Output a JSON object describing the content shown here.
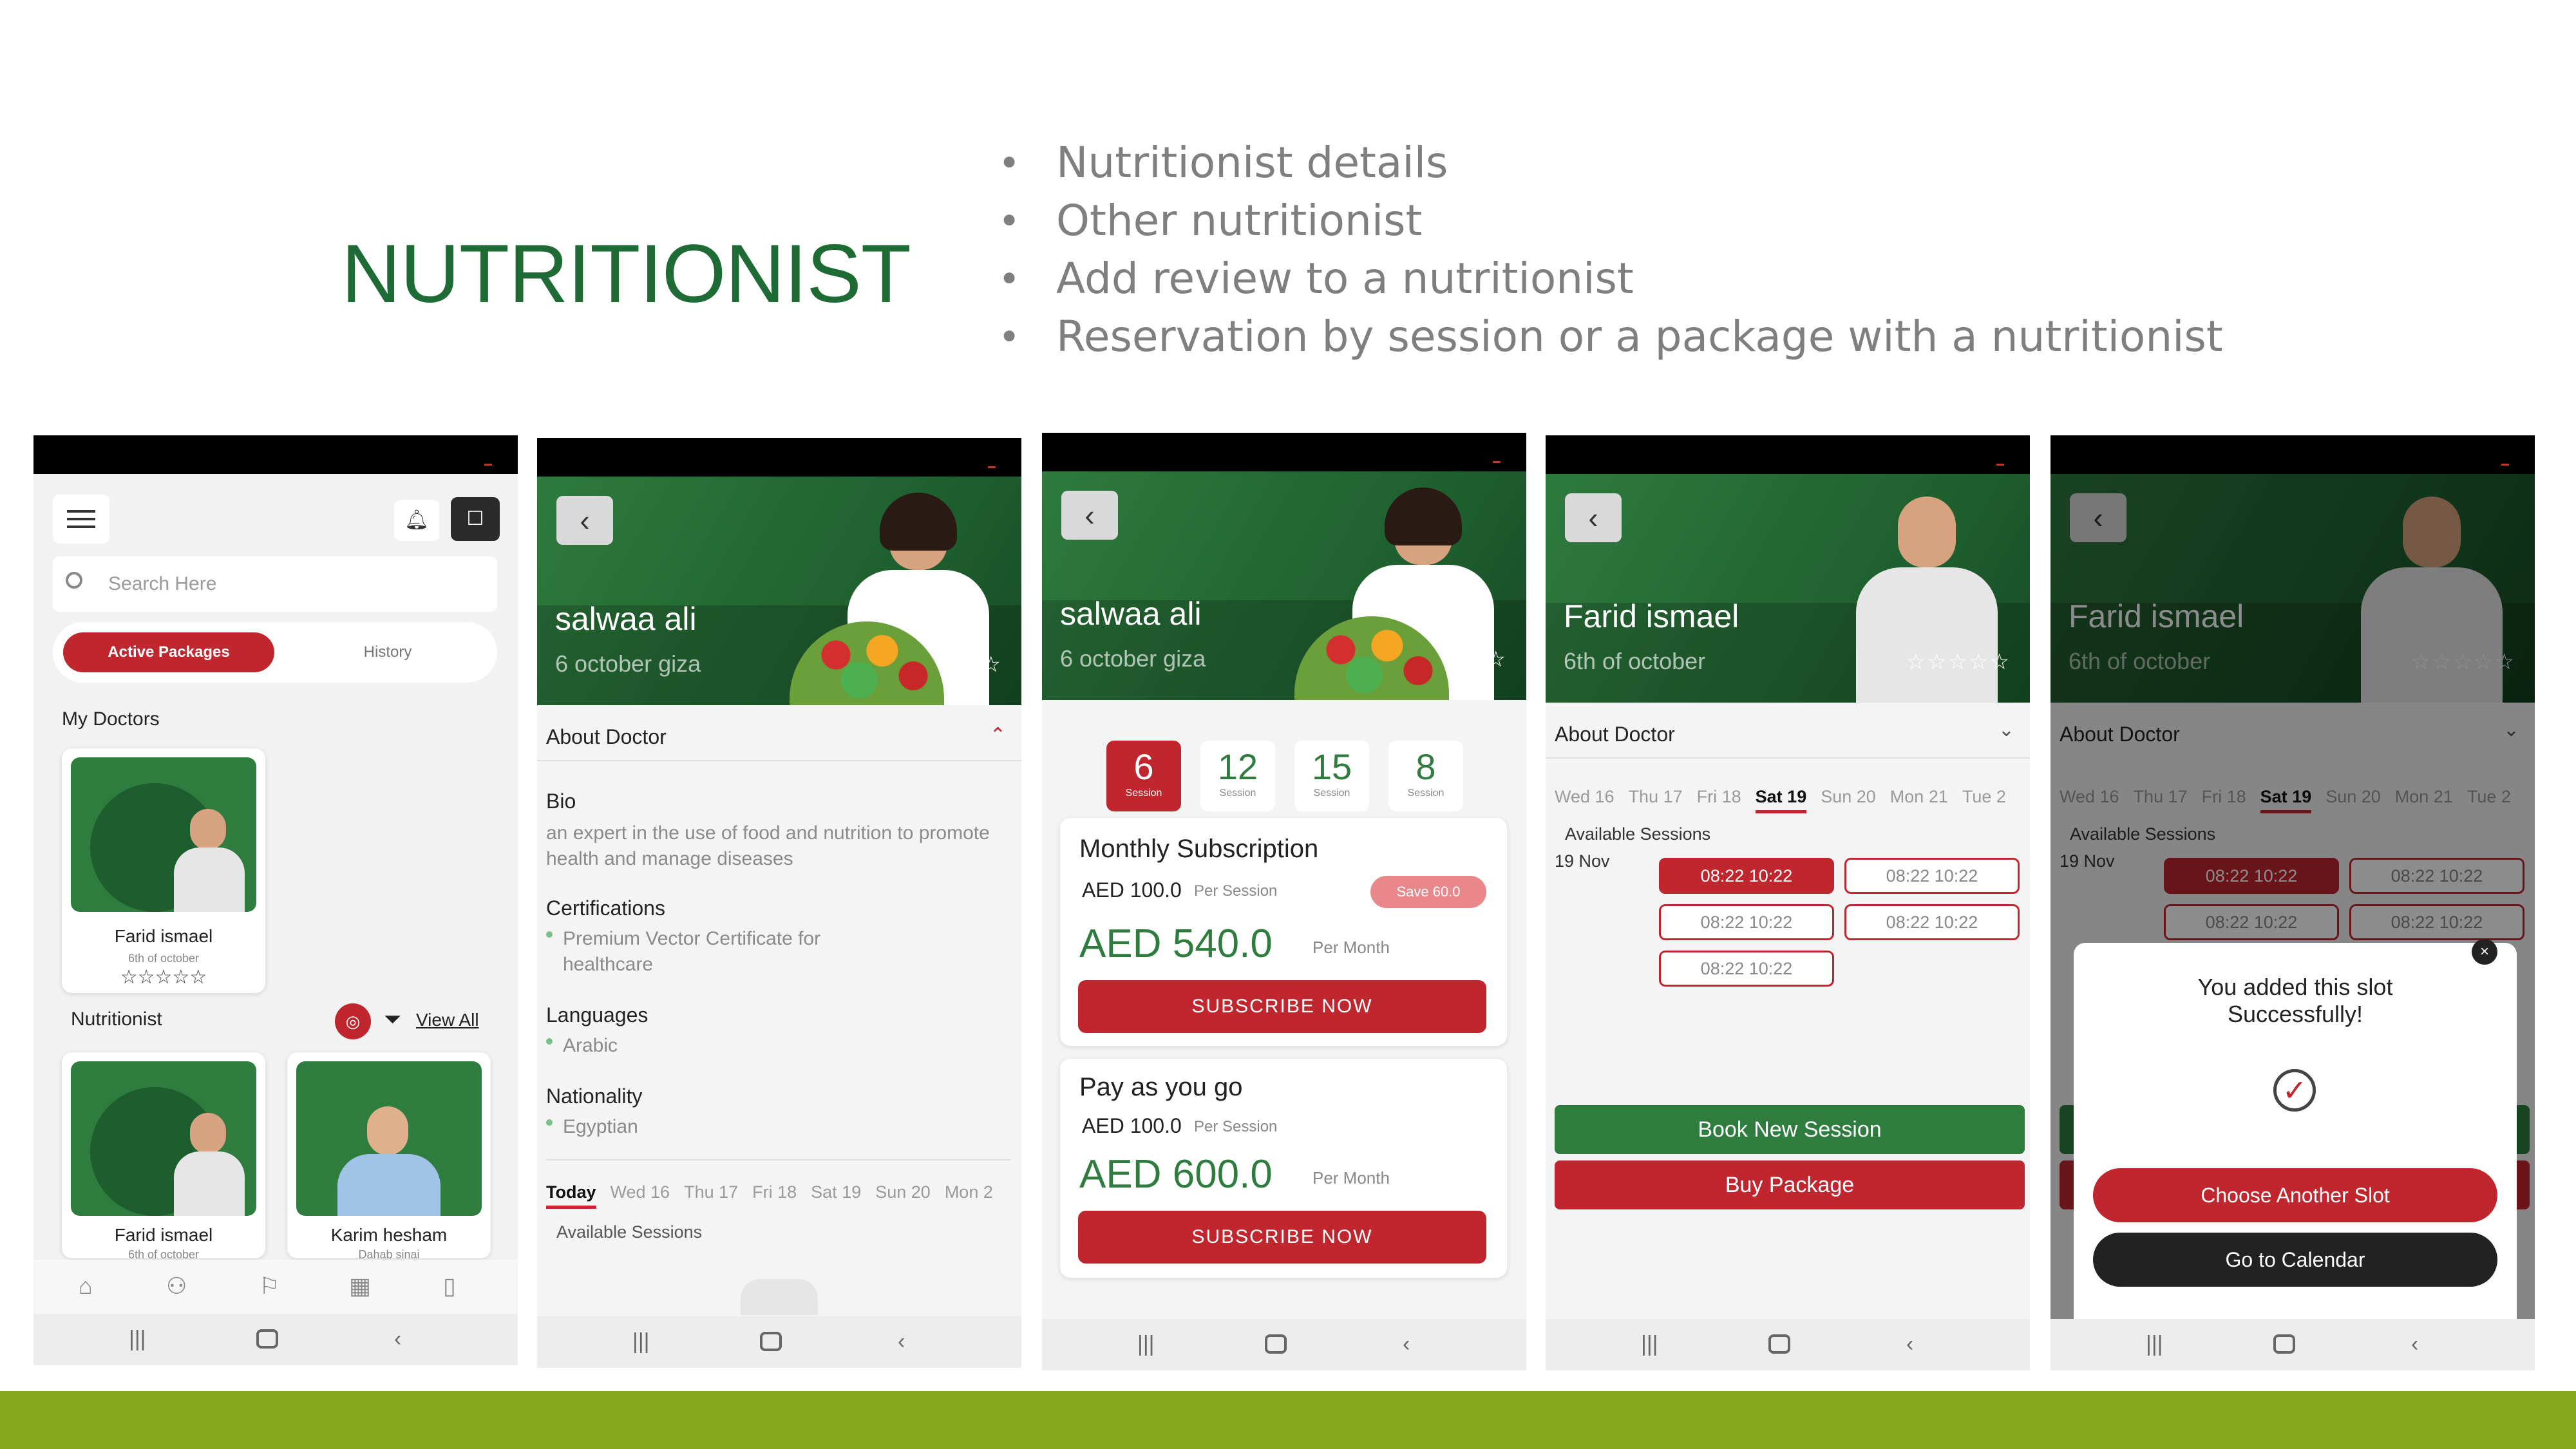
{
  "slide": {
    "title": "NUTRITIONIST",
    "bullets": [
      "Nutritionist details",
      "Other nutritionist",
      "Add review to a nutritionist",
      "Reservation by session or a package with a nutritionist"
    ],
    "colors": {
      "title": "#1f6b35",
      "bullet_text": "#7f7f7f",
      "bottom_bar": "#86a81e",
      "brand_green": "#2e7d3e",
      "brand_red": "#c0262e"
    }
  },
  "screen1": {
    "search_placeholder": "Search Here",
    "tabs": [
      "Active Packages",
      "History"
    ],
    "my_doctors_heading": "My Doctors",
    "my_doctor": {
      "name": "Farid ismael",
      "location": "6th of october",
      "stars": "☆☆☆☆☆"
    },
    "nutritionist_heading": "Nutritionist",
    "view_all": "View All",
    "nutritionists": [
      {
        "name": "Farid ismael",
        "location": "6th of october"
      },
      {
        "name": "Karim hesham",
        "location": "Dahab sinai"
      }
    ],
    "bottom_nav_icons": [
      "home-icon",
      "people-icon",
      "flag-icon",
      "calendar-icon",
      "phone-icon"
    ]
  },
  "screen2": {
    "name": "salwaa ali",
    "location": "6 october giza",
    "stars": "☆☆☆",
    "about": "About Doctor",
    "bio_label": "Bio",
    "bio_text": "an expert in the use of food and nutrition to promote health and manage diseases",
    "cert_label": "Certifications",
    "cert_text": "Premium Vector Certificate for healthcare",
    "lang_label": "Languages",
    "lang_text": "Arabic",
    "nat_label": "Nationality",
    "nat_text": "Egyptian",
    "days": [
      "Today",
      "Wed 16",
      "Thu 17",
      "Fri 18",
      "Sat 19",
      "Sun 20",
      "Mon 2"
    ],
    "available": "Available Sessions"
  },
  "screen3": {
    "name": "salwaa ali",
    "location": "6 october giza",
    "stars": "☆☆☆",
    "sessions": [
      {
        "num": "6",
        "label": "Session"
      },
      {
        "num": "12",
        "label": "Session"
      },
      {
        "num": "15",
        "label": "Session"
      },
      {
        "num": "8",
        "label": "Session"
      }
    ],
    "monthly": {
      "title": "Monthly Subscription",
      "per_session": "AED 100.0",
      "per_session_label": "Per Session",
      "save": "Save 60.0",
      "price": "AED 540.0",
      "per_month": "Per Month",
      "button": "SUBSCRIBE NOW"
    },
    "payg": {
      "title": "Pay as you go",
      "per_session": "AED 100.0",
      "per_session_label": "Per Session",
      "price": "AED 600.0",
      "per_month": "Per Month",
      "button": "SUBSCRIBE NOW"
    }
  },
  "screen4": {
    "name": "Farid ismael",
    "location": "6th of october",
    "stars": "☆☆☆☆☆",
    "about": "About Doctor",
    "days": [
      "Wed 16",
      "Thu 17",
      "Fri 18",
      "Sat 19",
      "Sun 20",
      "Mon 21",
      "Tue 2"
    ],
    "available": "Available Sessions",
    "date": "19 Nov",
    "slots": [
      "08:22  10:22",
      "08:22  10:22",
      "08:22  10:22",
      "08:22  10:22",
      "08:22  10:22"
    ],
    "book_button": "Book New Session",
    "package_button": "Buy Package"
  },
  "screen5": {
    "name": "Farid ismael",
    "location": "6th of october",
    "stars": "☆☆☆☆☆",
    "about": "About Doctor",
    "days": [
      "Wed 16",
      "Thu 17",
      "Fri 18",
      "Sat 19",
      "Sun 20",
      "Mon 21",
      "Tue 2"
    ],
    "available": "Available Sessions",
    "date": "19 Nov",
    "slots": [
      "08:22  10:22",
      "08:22  10:22",
      "08:22  10:22",
      "08:22  10:22"
    ],
    "modal_text": "You added this slot Successfully!",
    "choose_button": "Choose Another Slot",
    "calendar_button": "Go to Calendar"
  }
}
